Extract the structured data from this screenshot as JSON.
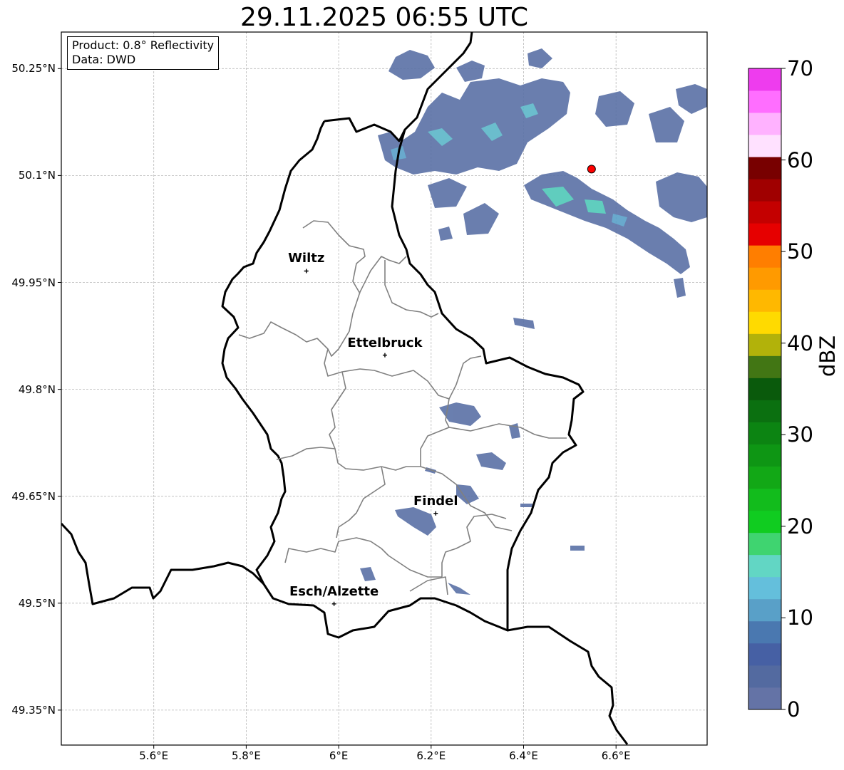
{
  "title": "29.11.2025 06:55 UTC",
  "info": {
    "product": "Product: 0.8° Reflectivity",
    "source": "Data: DWD"
  },
  "map": {
    "lon_range": [
      5.4,
      6.8
    ],
    "lat_range": [
      49.3,
      50.3
    ],
    "lat_ticks": [
      {
        "value": 50.25,
        "label": "50.25°N"
      },
      {
        "value": 50.1,
        "label": "50.1°N"
      },
      {
        "value": 49.95,
        "label": "49.95°N"
      },
      {
        "value": 49.8,
        "label": "49.8°N"
      },
      {
        "value": 49.65,
        "label": "49.65°N"
      },
      {
        "value": 49.5,
        "label": "49.5°N"
      },
      {
        "value": 49.35,
        "label": "49.35°N"
      }
    ],
    "lon_ticks": [
      {
        "value": 5.6,
        "label": "5.6°E"
      },
      {
        "value": 5.8,
        "label": "5.8°E"
      },
      {
        "value": 6.0,
        "label": "6°E"
      },
      {
        "value": 6.2,
        "label": "6.2°E"
      },
      {
        "value": 6.4,
        "label": "6.4°E"
      },
      {
        "value": 6.6,
        "label": "6.6°E"
      }
    ],
    "gridlines": true,
    "radar_site": {
      "lon": 6.547,
      "lat": 50.109,
      "color": "#ff0000"
    },
    "cities": [
      {
        "name": "Wiltz",
        "lon": 5.93,
        "lat": 49.966
      },
      {
        "name": "Ettelbruck",
        "lon": 6.1,
        "lat": 49.848
      },
      {
        "name": "Findel",
        "lon": 6.21,
        "lat": 49.626
      },
      {
        "name": "Esch/Alzette",
        "lon": 5.99,
        "lat": 49.499
      }
    ]
  },
  "colorbar": {
    "label": "dBZ",
    "min": 0,
    "max": 70,
    "tick_labels": [
      "0",
      "10",
      "20",
      "30",
      "40",
      "50",
      "60",
      "70"
    ],
    "colors": [
      "#6473a6",
      "#536aa0",
      "#4660a4",
      "#4a78b0",
      "#59a0c8",
      "#64bfdc",
      "#62d6c4",
      "#3fd470",
      "#10cc20",
      "#12bc1c",
      "#12a816",
      "#0e9614",
      "#0c8412",
      "#0b7010",
      "#0a5a0c",
      "#427614",
      "#b2b20a",
      "#ffda00",
      "#ffb800",
      "#ff9a00",
      "#ff7e00",
      "#e60000",
      "#c40000",
      "#a00000",
      "#780000",
      "#ffe1ff",
      "#ffb2ff",
      "#ff6eff",
      "#ee3cee"
    ]
  }
}
